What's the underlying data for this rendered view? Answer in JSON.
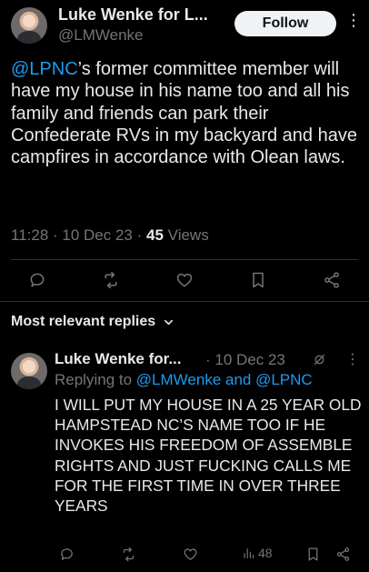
{
  "tweet": {
    "author_name": "Luke Wenke for L...",
    "author_handle": "@LMWenke",
    "follow_label": "Follow",
    "more_label": "⋮",
    "text_mention": "@LPNC",
    "text_rest": "’s former committee member will have my house in his name too and all his family and friends can park their Confederate RVs in my backyard and have campfires in accordance with Olean laws.",
    "time": "11:28",
    "date": "10 Dec 23",
    "views_count": "45",
    "views_label": "Views",
    "actions": [
      "reply-icon",
      "retweet-icon",
      "like-icon",
      "bookmark-icon",
      "share-icon"
    ]
  },
  "replies_section": {
    "title": "Most relevant replies",
    "chevron": "⌄"
  },
  "reply": {
    "author_name": "Luke Wenke for...",
    "date": "10 Dec 23",
    "replying_to_label": "Replying to",
    "replying_to_handles": "@LMWenke and @LPNC",
    "text": "I WILL PUT MY HOUSE IN A 25 YEAR OLD HAMPSTEAD NC’S NAME TOO IF HE INVOKES HIS FREEDOM OF ASSEMBLE RIGHTS AND JUST FUCKING CALLS ME FOR THE FIRST TIME IN OVER THREE YEARS",
    "views_count": "48",
    "more_label": "⋮"
  }
}
